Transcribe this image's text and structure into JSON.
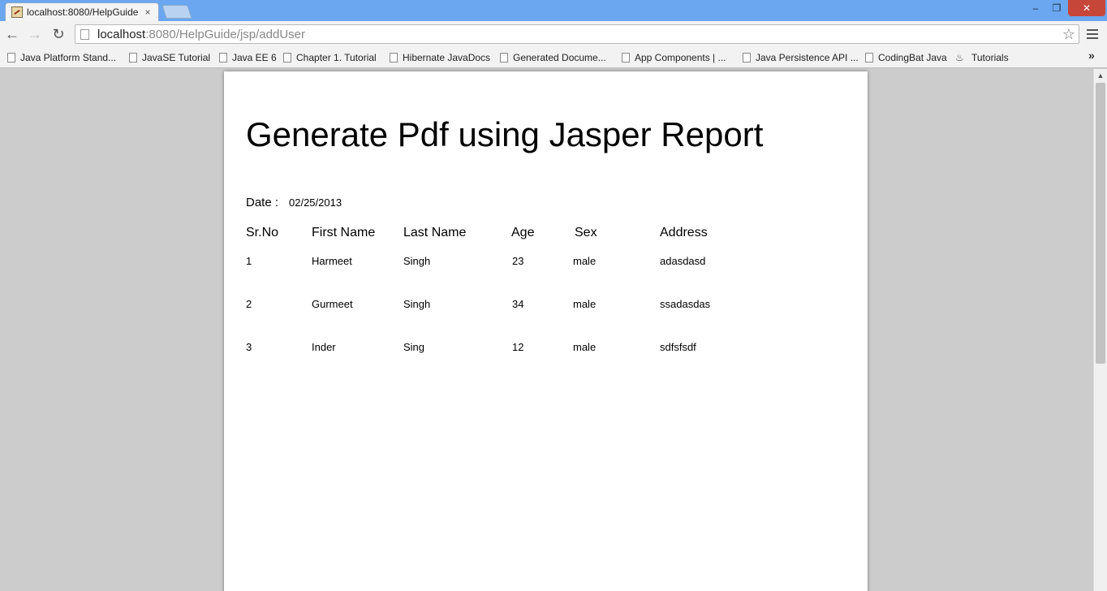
{
  "browser": {
    "tab_title": "localhost:8080/HelpGuide",
    "tab_close": "×",
    "window_controls": {
      "minimize": "–",
      "maximize": "❐",
      "close": "✕"
    },
    "nav": {
      "back": "←",
      "forward": "→",
      "reload": "↻"
    },
    "url_host": "localhost",
    "url_rest": ":8080/HelpGuide/jsp/addUser",
    "star": "☆",
    "bookmarks": [
      "Java Platform Stand...",
      "JavaSE Tutorial",
      "Java EE 6",
      "Chapter 1. Tutorial",
      "Hibernate JavaDocs",
      "Generated Docume...",
      "App Components | ...",
      "Java Persistence API ...",
      "CodingBat Java",
      "Tutorials"
    ],
    "bookmarks_more": "»"
  },
  "report": {
    "title": "Generate Pdf using Jasper Report",
    "date_label": "Date :",
    "date_value": "02/25/2013",
    "columns": [
      "Sr.No",
      "First Name",
      "Last Name",
      "Age",
      "Sex",
      "Address"
    ],
    "rows": [
      [
        "1",
        "Harmeet",
        "Singh",
        "23",
        "male",
        "adasdasd"
      ],
      [
        "2",
        "Gurmeet",
        "Singh",
        "34",
        "male",
        "ssadasdas"
      ],
      [
        "3",
        "Inder",
        "Sing",
        "12",
        "male",
        "sdfsfsdf"
      ]
    ]
  }
}
